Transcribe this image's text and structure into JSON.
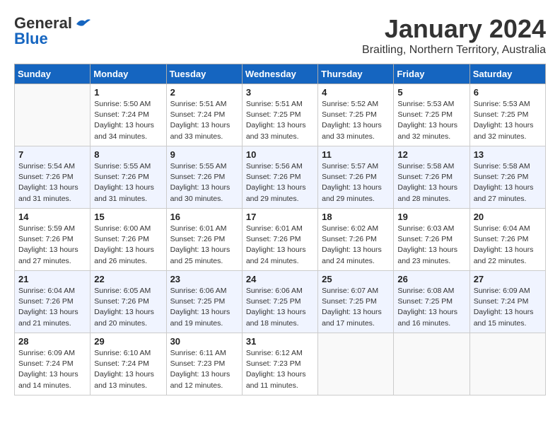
{
  "header": {
    "logo_general": "General",
    "logo_blue": "Blue",
    "month": "January 2024",
    "location": "Braitling, Northern Territory, Australia"
  },
  "weekdays": [
    "Sunday",
    "Monday",
    "Tuesday",
    "Wednesday",
    "Thursday",
    "Friday",
    "Saturday"
  ],
  "weeks": [
    [
      {
        "day": "",
        "sunrise": "",
        "sunset": "",
        "daylight": ""
      },
      {
        "day": "1",
        "sunrise": "Sunrise: 5:50 AM",
        "sunset": "Sunset: 7:24 PM",
        "daylight": "Daylight: 13 hours and 34 minutes."
      },
      {
        "day": "2",
        "sunrise": "Sunrise: 5:51 AM",
        "sunset": "Sunset: 7:24 PM",
        "daylight": "Daylight: 13 hours and 33 minutes."
      },
      {
        "day": "3",
        "sunrise": "Sunrise: 5:51 AM",
        "sunset": "Sunset: 7:25 PM",
        "daylight": "Daylight: 13 hours and 33 minutes."
      },
      {
        "day": "4",
        "sunrise": "Sunrise: 5:52 AM",
        "sunset": "Sunset: 7:25 PM",
        "daylight": "Daylight: 13 hours and 33 minutes."
      },
      {
        "day": "5",
        "sunrise": "Sunrise: 5:53 AM",
        "sunset": "Sunset: 7:25 PM",
        "daylight": "Daylight: 13 hours and 32 minutes."
      },
      {
        "day": "6",
        "sunrise": "Sunrise: 5:53 AM",
        "sunset": "Sunset: 7:25 PM",
        "daylight": "Daylight: 13 hours and 32 minutes."
      }
    ],
    [
      {
        "day": "7",
        "sunrise": "Sunrise: 5:54 AM",
        "sunset": "Sunset: 7:26 PM",
        "daylight": "Daylight: 13 hours and 31 minutes."
      },
      {
        "day": "8",
        "sunrise": "Sunrise: 5:55 AM",
        "sunset": "Sunset: 7:26 PM",
        "daylight": "Daylight: 13 hours and 31 minutes."
      },
      {
        "day": "9",
        "sunrise": "Sunrise: 5:55 AM",
        "sunset": "Sunset: 7:26 PM",
        "daylight": "Daylight: 13 hours and 30 minutes."
      },
      {
        "day": "10",
        "sunrise": "Sunrise: 5:56 AM",
        "sunset": "Sunset: 7:26 PM",
        "daylight": "Daylight: 13 hours and 29 minutes."
      },
      {
        "day": "11",
        "sunrise": "Sunrise: 5:57 AM",
        "sunset": "Sunset: 7:26 PM",
        "daylight": "Daylight: 13 hours and 29 minutes."
      },
      {
        "day": "12",
        "sunrise": "Sunrise: 5:58 AM",
        "sunset": "Sunset: 7:26 PM",
        "daylight": "Daylight: 13 hours and 28 minutes."
      },
      {
        "day": "13",
        "sunrise": "Sunrise: 5:58 AM",
        "sunset": "Sunset: 7:26 PM",
        "daylight": "Daylight: 13 hours and 27 minutes."
      }
    ],
    [
      {
        "day": "14",
        "sunrise": "Sunrise: 5:59 AM",
        "sunset": "Sunset: 7:26 PM",
        "daylight": "Daylight: 13 hours and 27 minutes."
      },
      {
        "day": "15",
        "sunrise": "Sunrise: 6:00 AM",
        "sunset": "Sunset: 7:26 PM",
        "daylight": "Daylight: 13 hours and 26 minutes."
      },
      {
        "day": "16",
        "sunrise": "Sunrise: 6:01 AM",
        "sunset": "Sunset: 7:26 PM",
        "daylight": "Daylight: 13 hours and 25 minutes."
      },
      {
        "day": "17",
        "sunrise": "Sunrise: 6:01 AM",
        "sunset": "Sunset: 7:26 PM",
        "daylight": "Daylight: 13 hours and 24 minutes."
      },
      {
        "day": "18",
        "sunrise": "Sunrise: 6:02 AM",
        "sunset": "Sunset: 7:26 PM",
        "daylight": "Daylight: 13 hours and 24 minutes."
      },
      {
        "day": "19",
        "sunrise": "Sunrise: 6:03 AM",
        "sunset": "Sunset: 7:26 PM",
        "daylight": "Daylight: 13 hours and 23 minutes."
      },
      {
        "day": "20",
        "sunrise": "Sunrise: 6:04 AM",
        "sunset": "Sunset: 7:26 PM",
        "daylight": "Daylight: 13 hours and 22 minutes."
      }
    ],
    [
      {
        "day": "21",
        "sunrise": "Sunrise: 6:04 AM",
        "sunset": "Sunset: 7:26 PM",
        "daylight": "Daylight: 13 hours and 21 minutes."
      },
      {
        "day": "22",
        "sunrise": "Sunrise: 6:05 AM",
        "sunset": "Sunset: 7:26 PM",
        "daylight": "Daylight: 13 hours and 20 minutes."
      },
      {
        "day": "23",
        "sunrise": "Sunrise: 6:06 AM",
        "sunset": "Sunset: 7:25 PM",
        "daylight": "Daylight: 13 hours and 19 minutes."
      },
      {
        "day": "24",
        "sunrise": "Sunrise: 6:06 AM",
        "sunset": "Sunset: 7:25 PM",
        "daylight": "Daylight: 13 hours and 18 minutes."
      },
      {
        "day": "25",
        "sunrise": "Sunrise: 6:07 AM",
        "sunset": "Sunset: 7:25 PM",
        "daylight": "Daylight: 13 hours and 17 minutes."
      },
      {
        "day": "26",
        "sunrise": "Sunrise: 6:08 AM",
        "sunset": "Sunset: 7:25 PM",
        "daylight": "Daylight: 13 hours and 16 minutes."
      },
      {
        "day": "27",
        "sunrise": "Sunrise: 6:09 AM",
        "sunset": "Sunset: 7:24 PM",
        "daylight": "Daylight: 13 hours and 15 minutes."
      }
    ],
    [
      {
        "day": "28",
        "sunrise": "Sunrise: 6:09 AM",
        "sunset": "Sunset: 7:24 PM",
        "daylight": "Daylight: 13 hours and 14 minutes."
      },
      {
        "day": "29",
        "sunrise": "Sunrise: 6:10 AM",
        "sunset": "Sunset: 7:24 PM",
        "daylight": "Daylight: 13 hours and 13 minutes."
      },
      {
        "day": "30",
        "sunrise": "Sunrise: 6:11 AM",
        "sunset": "Sunset: 7:23 PM",
        "daylight": "Daylight: 13 hours and 12 minutes."
      },
      {
        "day": "31",
        "sunrise": "Sunrise: 6:12 AM",
        "sunset": "Sunset: 7:23 PM",
        "daylight": "Daylight: 13 hours and 11 minutes."
      },
      {
        "day": "",
        "sunrise": "",
        "sunset": "",
        "daylight": ""
      },
      {
        "day": "",
        "sunrise": "",
        "sunset": "",
        "daylight": ""
      },
      {
        "day": "",
        "sunrise": "",
        "sunset": "",
        "daylight": ""
      }
    ]
  ]
}
